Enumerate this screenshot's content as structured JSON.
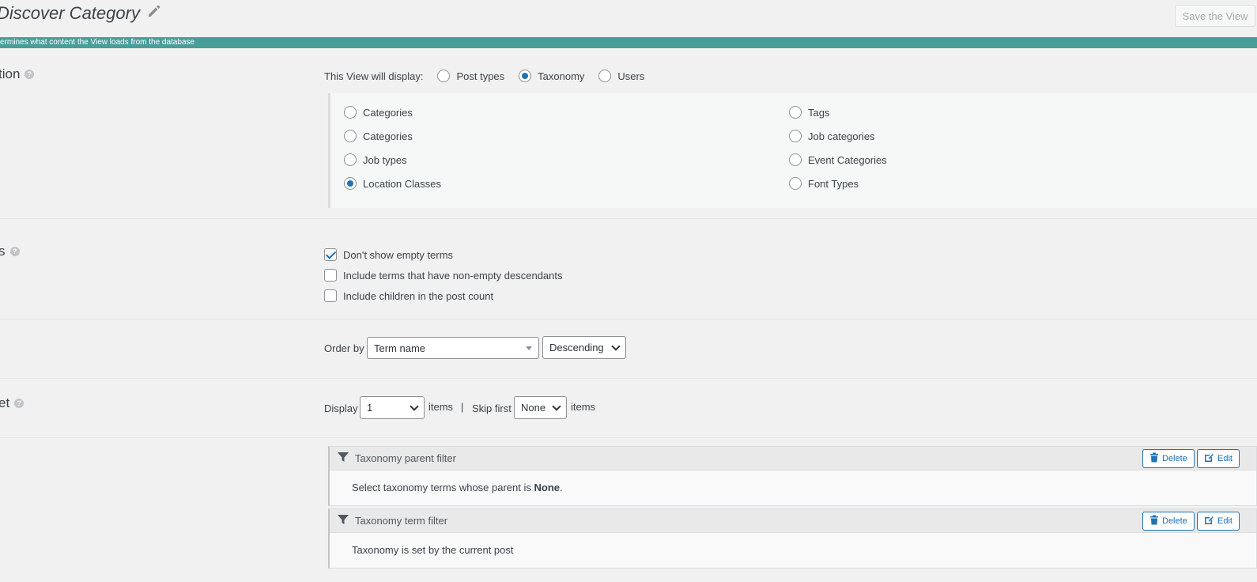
{
  "header": {
    "title": "Discover Category",
    "save_label": "Save the View",
    "banner_text": "ermines what content the View loads from the database"
  },
  "sections": {
    "selection_label": "tion",
    "options_label": "s",
    "limit_label": "et"
  },
  "display": {
    "label": "This View will display:",
    "options": [
      "Post types",
      "Taxonomy",
      "Users"
    ],
    "selected": "Taxonomy"
  },
  "taxonomies": {
    "left": [
      "Categories",
      "Categories",
      "Job types",
      "Location Classes"
    ],
    "right": [
      "Tags",
      "Job categories",
      "Event Categories",
      "Font Types"
    ],
    "selected": "Location Classes"
  },
  "term_options": [
    {
      "label": "Don't show empty terms",
      "checked": true
    },
    {
      "label": "Include terms that have non-empty descendants",
      "checked": false
    },
    {
      "label": "Include children in the post count",
      "checked": false
    }
  ],
  "ordering": {
    "label": "Order by",
    "field": "Term name",
    "direction": "Descending"
  },
  "limit": {
    "display_label": "Display",
    "display_value": "1",
    "items_label": "items",
    "divider": "|",
    "skip_label": "Skip first",
    "skip_value": "None",
    "items_label2": "items"
  },
  "filters": [
    {
      "title": "Taxonomy parent filter",
      "body_prefix": "Select taxonomy terms whose parent is ",
      "body_bold": "None",
      "body_suffix": ".",
      "delete_label": "Delete",
      "edit_label": "Edit"
    },
    {
      "title": "Taxonomy term filter",
      "body_prefix": "Taxonomy is set by the current post",
      "body_bold": "",
      "body_suffix": "",
      "delete_label": "Delete",
      "edit_label": "Edit"
    }
  ],
  "colors": {
    "accent": "#2271b1",
    "banner": "#4a9e9a"
  }
}
